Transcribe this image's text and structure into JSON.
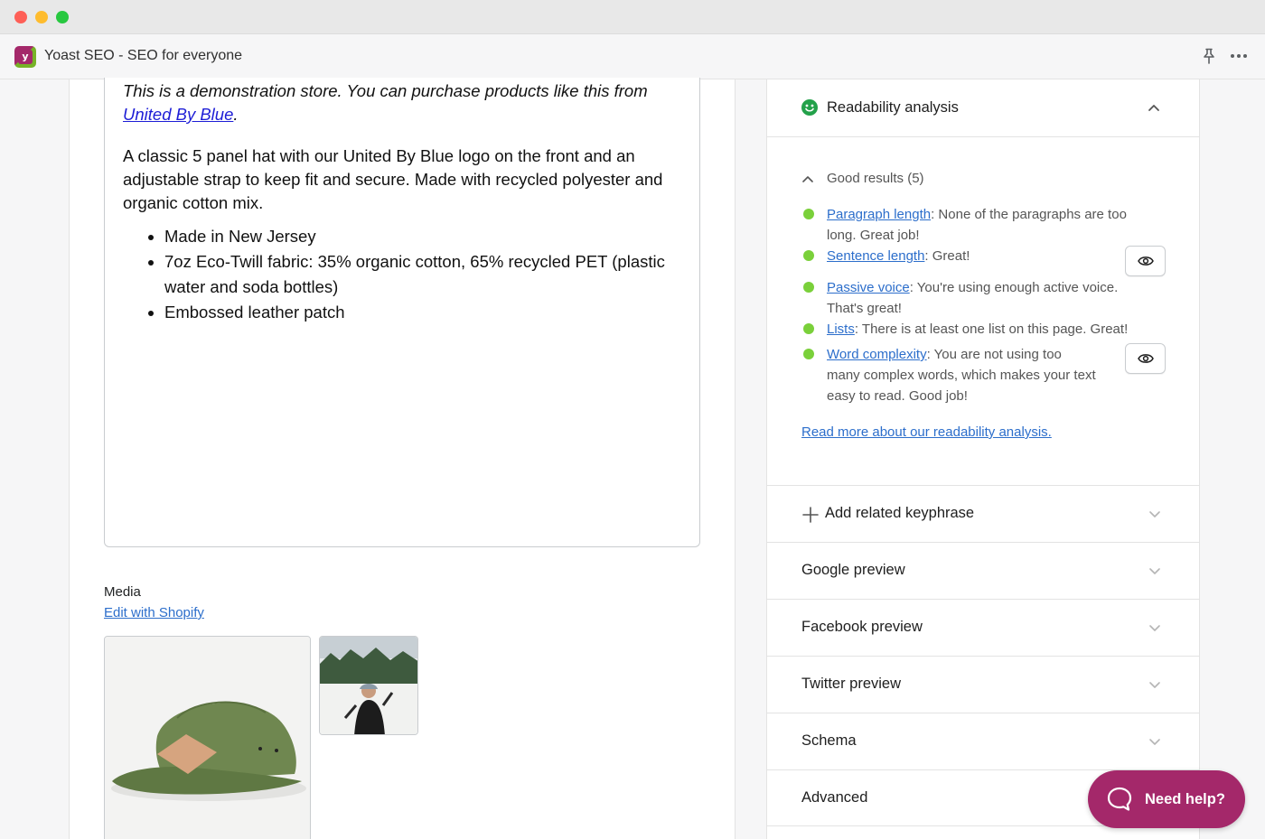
{
  "window": {
    "app_title": "Yoast SEO - SEO for everyone",
    "logo_letter": "y"
  },
  "editor": {
    "demo_prefix": "This is a demonstration store. You can purchase products like this from ",
    "demo_link": "United By Blue",
    "demo_suffix": ".",
    "description": "A classic 5 panel hat with our United By Blue logo on the front and an adjustable strap to keep fit and secure. Made with recycled polyester and organic cotton mix.",
    "bullets": [
      "Made in New Jersey",
      "7oz Eco-Twill fabric: 35% organic cotton, 65% recycled PET (plastic water and soda bottles)",
      "Embossed leather patch"
    ]
  },
  "media": {
    "label": "Media",
    "edit_link": "Edit with Shopify"
  },
  "readability": {
    "title": "Readability analysis",
    "good_results_label": "Good results (5)",
    "results": [
      {
        "link": "Paragraph length",
        "text": ": None of the paragraphs are too long. Great job!"
      },
      {
        "link": "Sentence length",
        "text": ": Great!"
      },
      {
        "link": "Passive voice",
        "text": ": You're using enough active voice. That's great!"
      },
      {
        "link": "Lists",
        "text": ": There is at least one list on this page. Great!"
      },
      {
        "link": "Word complexity",
        "text": ": You are not using too many complex words, which makes your text easy to read. Good job!"
      }
    ],
    "read_more": "Read more about our readability analysis."
  },
  "sections": {
    "add_keyphrase": "Add related keyphrase",
    "google_preview": "Google preview",
    "facebook_preview": "Facebook preview",
    "twitter_preview": "Twitter preview",
    "schema": "Schema",
    "advanced": "Advanced"
  },
  "help": {
    "label": "Need help?"
  },
  "colors": {
    "brand": "#a4286a",
    "good_bullet": "#7ad03a",
    "link": "#2c6ecb"
  }
}
